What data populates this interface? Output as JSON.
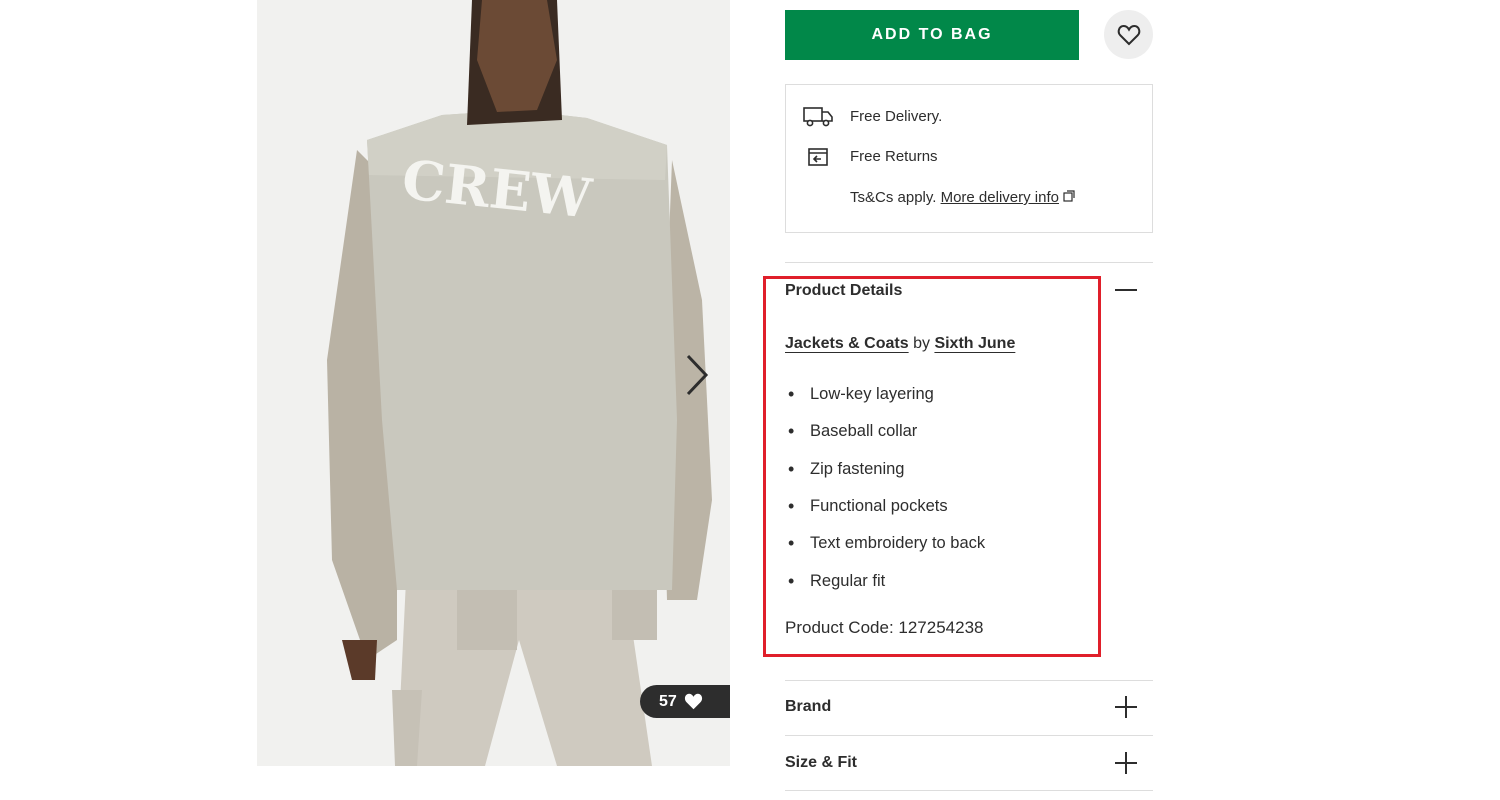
{
  "gallery": {
    "image_alt": "Model wearing vest with CREW embroidery on back",
    "embroidery_text": "CREW",
    "likes_count": "57",
    "icons": {
      "next": "chevron-right-icon",
      "likes": "heart-filled-icon"
    }
  },
  "actions": {
    "add_to_bag_label": "ADD TO BAG",
    "wishlist_icon": "heart-outline-icon",
    "accent_color": "#018849"
  },
  "delivery": {
    "free_delivery": "Free Delivery.",
    "free_returns": "Free Returns",
    "terms_text": "Ts&Cs apply.",
    "more_info_link": "More delivery info",
    "icons": [
      "truck-icon",
      "returns-box-icon",
      "external-link-icon"
    ]
  },
  "product_details": {
    "title": "Product Details",
    "category_link": "Jackets & Coats",
    "by_text": "by",
    "brand_link": "Sixth June",
    "features": [
      "Low-key layering",
      "Baseball collar",
      "Zip fastening",
      "Functional pockets",
      "Text embroidery to back",
      "Regular fit"
    ],
    "product_code": "Product Code: 127254238",
    "expanded": true
  },
  "accordions": {
    "brand": "Brand",
    "size_fit": "Size & Fit"
  },
  "highlight_color": "#e01f2a"
}
